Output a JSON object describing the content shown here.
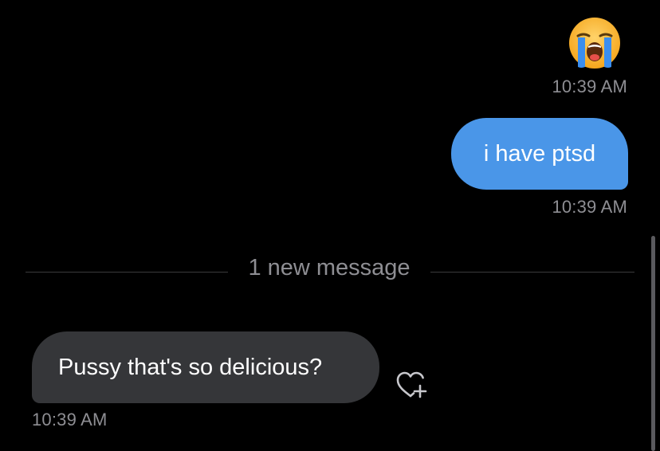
{
  "messages": [
    {
      "direction": "outgoing",
      "kind": "emoji",
      "icon": "loudly-crying-face-emoji-icon",
      "timestamp": "10:39 AM"
    },
    {
      "direction": "outgoing",
      "kind": "text",
      "text": "i have ptsd",
      "timestamp": "10:39 AM",
      "bubble_color": "#4a96e8"
    },
    {
      "direction": "incoming",
      "kind": "text",
      "text": "Pussy that's so delicious?",
      "timestamp": "10:39 AM",
      "bubble_color": "#353639"
    }
  ],
  "new_message_divider": {
    "label": "1 new message"
  },
  "reaction_button": {
    "icon": "heart-plus-icon"
  },
  "colors": {
    "background": "#000000",
    "timestamp": "#8e8e93",
    "divider_line": "#3a3a3c"
  }
}
